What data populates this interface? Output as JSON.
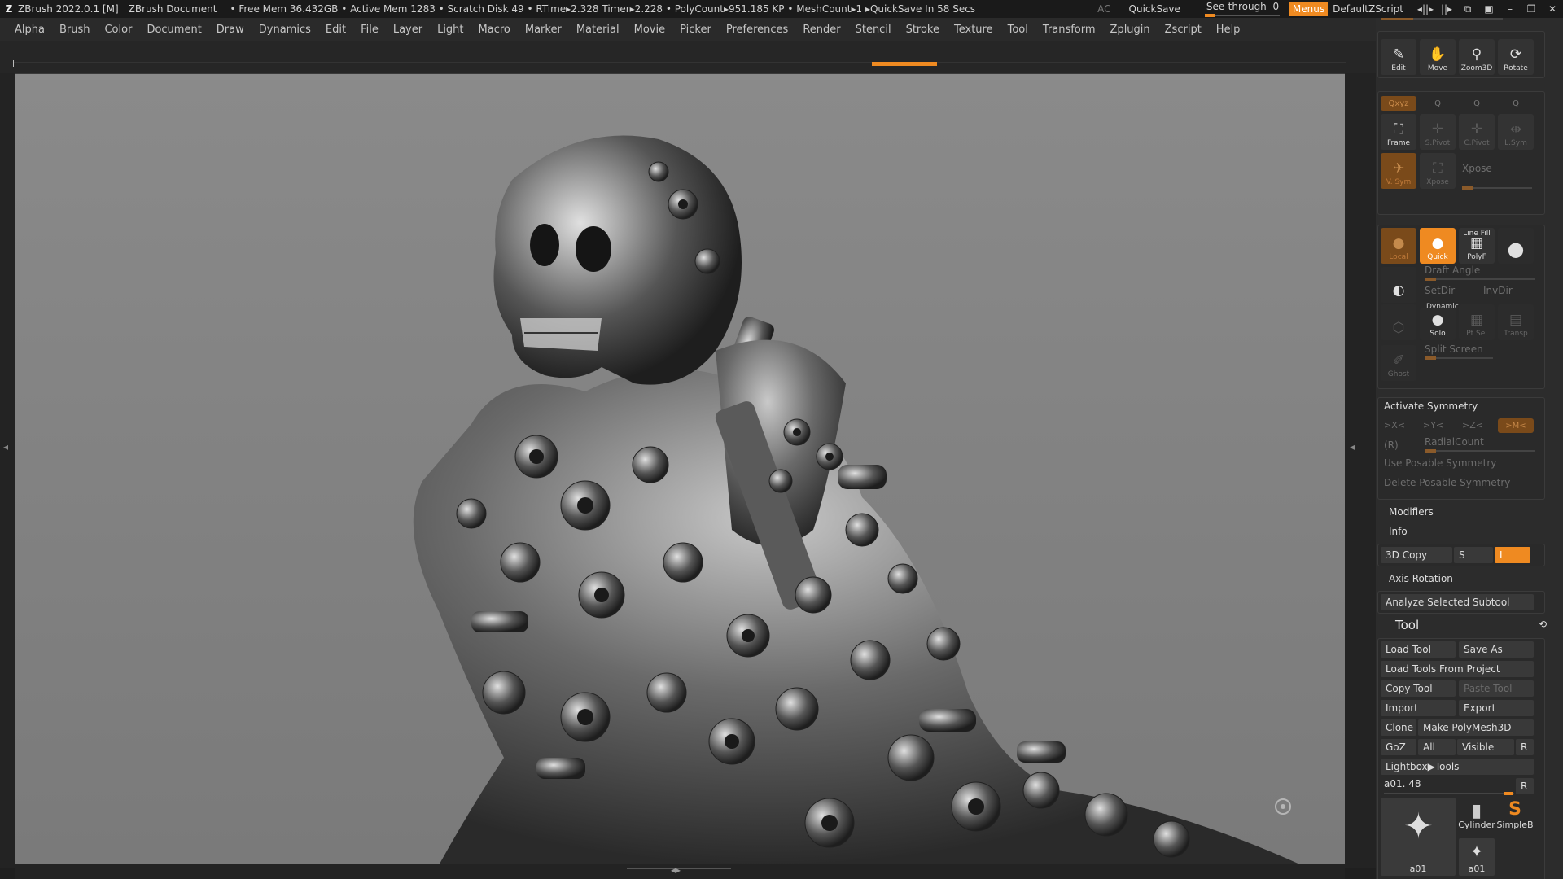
{
  "titlebar": {
    "app": "ZBrush 2022.0.1 [M]",
    "document": "ZBrush Document",
    "stats": "• Free Mem 36.432GB • Active Mem 1283 • Scratch Disk 49 •  RTime▸2.328 Timer▸2.228 • PolyCount▸951.185 KP  • MeshCount▸1  ▸QuickSave In 58 Secs",
    "ac": "AC",
    "quicksave": "QuickSave",
    "see_through_label": "See-through",
    "see_through_value": "0",
    "see_through_level": 0,
    "menus": "Menus",
    "default_zscript": "DefaultZScript"
  },
  "menubar": [
    "Alpha",
    "Brush",
    "Color",
    "Document",
    "Draw",
    "Dynamics",
    "Edit",
    "File",
    "Layer",
    "Light",
    "Macro",
    "Marker",
    "Material",
    "Movie",
    "Picker",
    "Preferences",
    "Render",
    "Stencil",
    "Stroke",
    "Texture",
    "Tool",
    "Transform",
    "Zplugin",
    "Zscript",
    "Help"
  ],
  "right_panel": {
    "nav": {
      "edit": "Edit",
      "move": "Move",
      "zoom3d": "Zoom3D",
      "rotate": "Rotate"
    },
    "axis_tabs": {
      "xyz": "Qxyz",
      "y": "Q",
      "z": "Q",
      "r": "Q"
    },
    "view": {
      "frame": "Frame",
      "spivot": "S.Pivot",
      "cpivot": "C.Pivot",
      "lsym": "L.Sym",
      "vsym": "V. Sym",
      "xpose_btn": "Xpose",
      "xpose_label": "Xpose"
    },
    "poly": {
      "local": "Local",
      "quick": "Quick",
      "line_fill": "Line Fill",
      "polyf": "PolyF"
    },
    "draft_angle": "Draft Angle",
    "setdir": "SetDir",
    "invdir": "InvDir",
    "dynamic": "Dynamic",
    "solo": "Solo",
    "ptsel": "Pt Sel",
    "transp": "Transp",
    "ghost": "Ghost",
    "split_screen": "Split Screen",
    "symmetry": {
      "activate": "Activate Symmetry",
      "x": ">X<",
      "y": ">Y<",
      "z": ">Z<",
      "m": ">M<",
      "r": "(R)",
      "radial_count": "RadialCount",
      "use_posable": "Use Posable Symmetry",
      "delete_posable": "Delete Posable Symmetry"
    },
    "modifiers": "Modifiers",
    "info": "Info",
    "copy3d": "3D Copy",
    "s": "S",
    "i": "I",
    "axis_rotation": "Axis Rotation",
    "analyze": "Analyze Selected Subtool",
    "tool": {
      "title": "Tool",
      "load_tool": "Load Tool",
      "save_as": "Save As",
      "load_from_project": "Load Tools From Project",
      "copy_tool": "Copy Tool",
      "paste_tool": "Paste Tool",
      "import": "Import",
      "export": "Export",
      "clone": "Clone",
      "make_polymesh": "Make PolyMesh3D",
      "goz": "GoZ",
      "all": "All",
      "visible": "Visible",
      "r": "R",
      "lightbox": "Lightbox▶Tools",
      "current": "a01. 48",
      "r2": "R",
      "thumbs": {
        "a01_main": "a01",
        "cylinder": "Cylinder",
        "simpleb": "SimpleB",
        "a01_small": "a01"
      }
    }
  }
}
